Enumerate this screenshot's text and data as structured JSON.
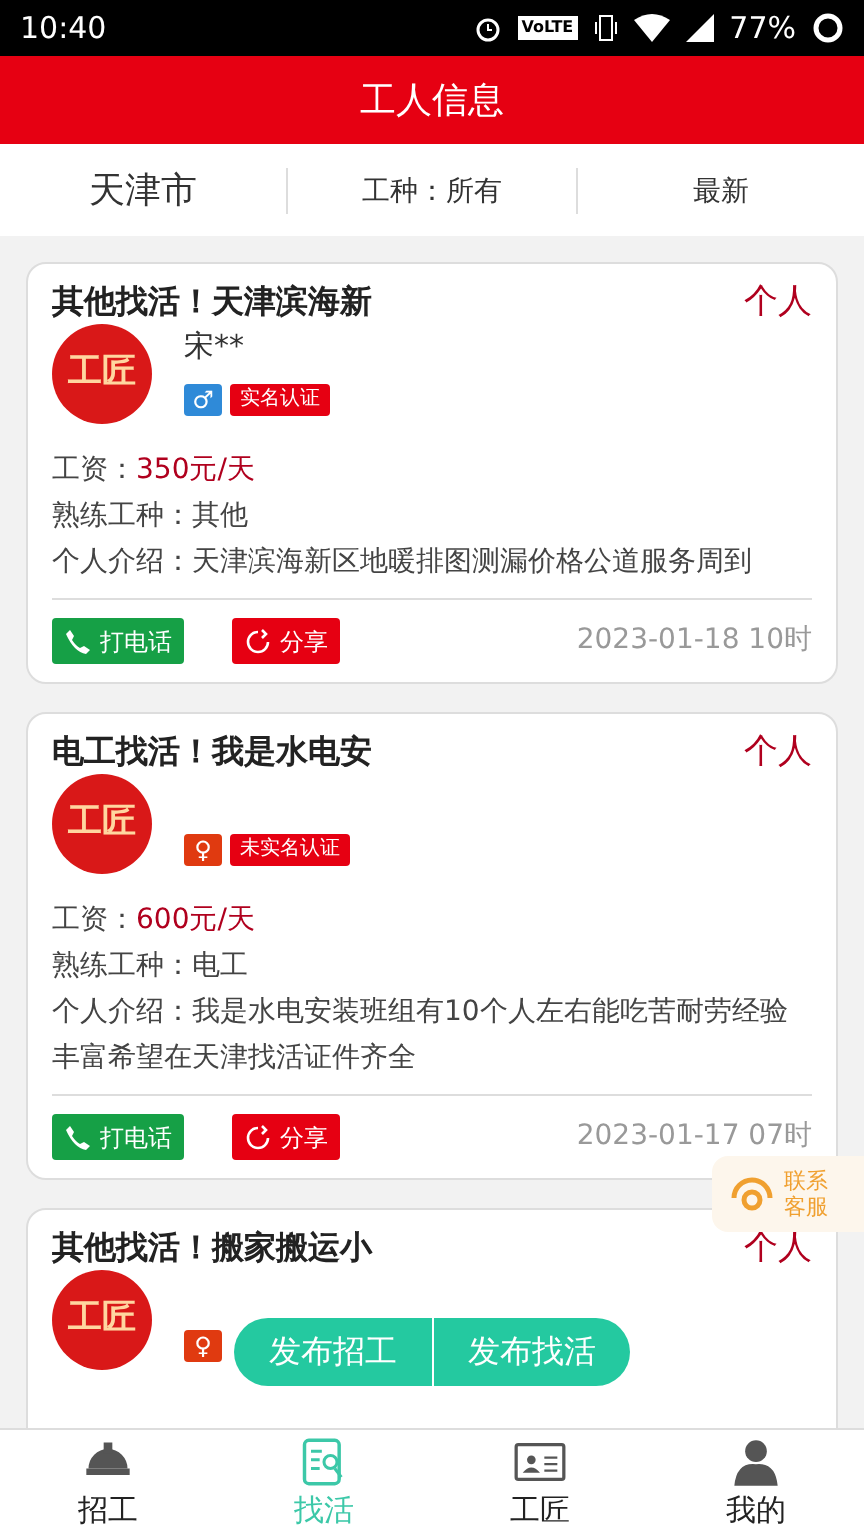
{
  "status_bar": {
    "time": "10:40",
    "volte": "VoLTE",
    "battery": "77%"
  },
  "header": {
    "title": "工人信息"
  },
  "filters": [
    {
      "label": "天津市",
      "kind": "city"
    },
    {
      "label": "工种：所有",
      "kind": "filter"
    },
    {
      "label": "最新",
      "kind": "filter"
    }
  ],
  "cards": [
    {
      "title": "其他找活！天津滨海新",
      "type": "个人",
      "avatar_text": "工匠",
      "name": "宋**",
      "gender": {
        "kind": "male",
        "symbol": "♂"
      },
      "verify_tag": "实名认证",
      "salary_label": "工资：",
      "salary": "350元/天",
      "trade": "熟练工种：其他",
      "intro": "个人介绍：天津滨海新区地暖排图测漏价格公道服务周到",
      "call_button": "打电话",
      "share_button": "分享",
      "time": "2023-01-18 10时"
    },
    {
      "title": "电工找活！我是水电安",
      "type": "个人",
      "avatar_text": "工匠",
      "gender": {
        "kind": "female",
        "symbol": "♀"
      },
      "verify_tag": "未实名认证",
      "salary_label": "工资：",
      "salary": "600元/天",
      "trade": "熟练工种：电工",
      "intro": "个人介绍：我是水电安装班组有10个人左右能吃苦耐劳经验丰富希望在天津找活证件齐全",
      "call_button": "打电话",
      "share_button": "分享",
      "time": "2023-01-17 07时"
    },
    {
      "title": "其他找活！搬家搬运小",
      "type": "个人",
      "avatar_text": "工匠",
      "gender": {
        "kind": "female",
        "symbol": "♀"
      }
    }
  ],
  "service_button": "联系客服",
  "publish_buttons": [
    "发布招工",
    "发布找活"
  ],
  "tabs": [
    {
      "label": "招工",
      "selected": false
    },
    {
      "label": "找活",
      "selected": true
    },
    {
      "label": "工匠",
      "selected": false
    },
    {
      "label": "我的",
      "selected": false
    }
  ]
}
